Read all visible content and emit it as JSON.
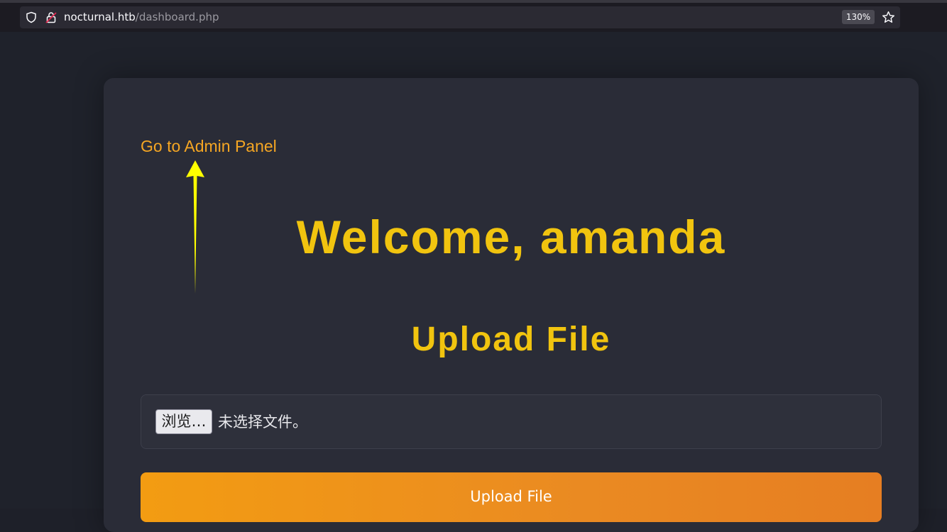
{
  "browser": {
    "url_host": "nocturnal.htb",
    "url_path": "/dashboard.php",
    "zoom": "130%"
  },
  "page": {
    "admin_link": "Go to Admin Panel",
    "welcome": "Welcome, amanda",
    "upload_heading": "Upload File",
    "browse_button": "浏览…",
    "no_file_text": "未选择文件。",
    "submit_button": "Upload File"
  },
  "colors": {
    "accent_yellow": "#f1c40f",
    "link_orange": "#f5a623",
    "button_orange": "#f39c12",
    "annotation_arrow": "#ffff00"
  },
  "icons": [
    "shield-icon",
    "lock-icon",
    "star-icon",
    "arrow-annotation"
  ]
}
